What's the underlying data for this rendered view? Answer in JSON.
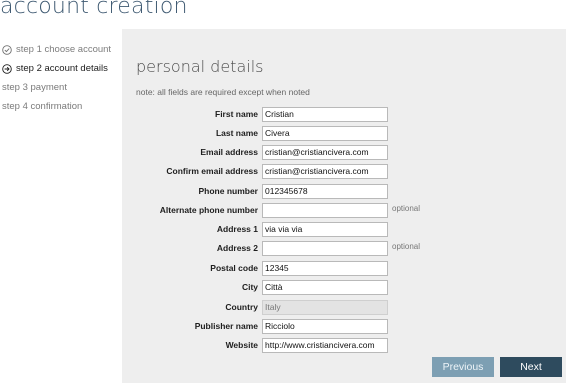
{
  "app": {
    "title": "account creation"
  },
  "sidebar": {
    "steps": [
      {
        "label": "step 1 choose account",
        "state": "done"
      },
      {
        "label": "step 2 account details",
        "state": "current"
      },
      {
        "label": "step 3 payment",
        "state": "todo"
      },
      {
        "label": "step 4 confirmation",
        "state": "todo"
      }
    ]
  },
  "main": {
    "section_title": "personal details",
    "note": "note: all fields are required except when noted",
    "optional_label": "optional",
    "fields": [
      {
        "label": "First name",
        "value": "Cristian"
      },
      {
        "label": "Last name",
        "value": "Civera"
      },
      {
        "label": "Email address",
        "value": "cristian@cristiancivera.com"
      },
      {
        "label": "Confirm email address",
        "value": "cristian@cristiancivera.com"
      },
      {
        "label": "Phone number",
        "value": "012345678"
      },
      {
        "label": "Alternate phone number",
        "value": ""
      },
      {
        "label": "Address 1",
        "value": "via via via"
      },
      {
        "label": "Address 2",
        "value": ""
      },
      {
        "label": "Postal code",
        "value": "12345"
      },
      {
        "label": "City",
        "value": "Città"
      },
      {
        "label": "Country",
        "value": "Italy"
      },
      {
        "label": "Publisher name",
        "value": "Ricciolo"
      },
      {
        "label": "Website",
        "value": "http://www.cristiancivera.com"
      }
    ]
  },
  "buttons": {
    "previous": "Previous",
    "next": "Next"
  },
  "colors": {
    "title": "#3f5a72",
    "panel_bg": "#eeeeee",
    "prev_button": "#7d9fb3",
    "next_button": "#2e4b5e"
  }
}
